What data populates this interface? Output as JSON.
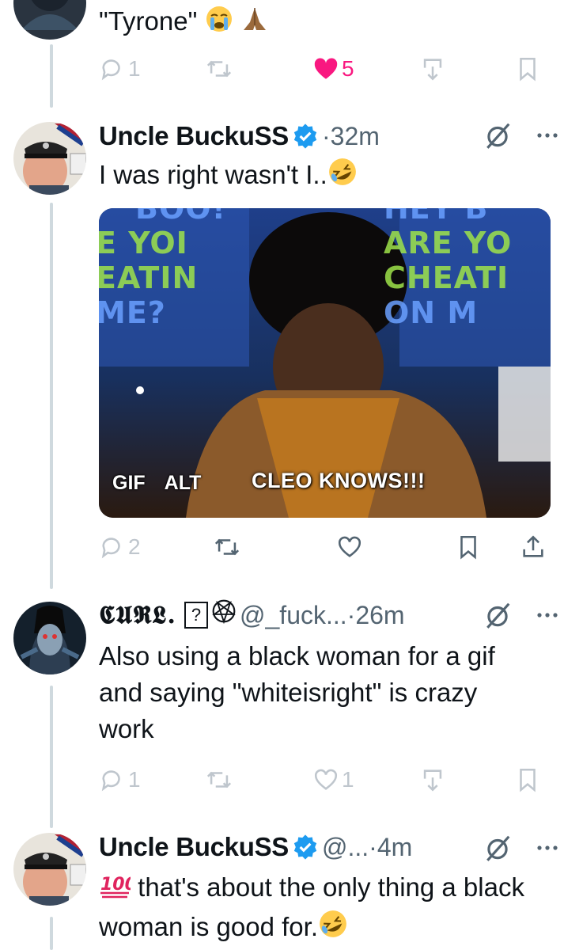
{
  "tweet1": {
    "text": "\"Tyrone\"",
    "emojis": [
      "crying-face",
      "folded-hands"
    ],
    "actions": {
      "reply_count": "1",
      "retweet_count": "",
      "like_count": "5",
      "liked": true
    }
  },
  "tweet2": {
    "name": "Uncle BuckuSS",
    "separator": "·",
    "time": "32m",
    "text": "I was right wasn't I..",
    "emoji": "rolling-on-floor-laughing",
    "media": {
      "badge_gif": "GIF",
      "badge_alt": "ALT",
      "caption": "CLEO KNOWS!!!",
      "banner_left": [
        "BOO!",
        "E YOI",
        "EATIN",
        "ME?"
      ],
      "banner_right": [
        "HEY B",
        "ARE YO",
        "CHEATI",
        "ON M"
      ]
    },
    "actions": {
      "reply_count": "2"
    }
  },
  "tweet3": {
    "name": "𝕮𝖀𝕽𝕷.",
    "name_box": "?",
    "handle": "@_fuck...",
    "separator": "·",
    "time": "26m",
    "text": "Also using a black woman for a gif and saying \"whiteisright\" is crazy work",
    "actions": {
      "reply_count": "1",
      "like_count": "1"
    }
  },
  "tweet4": {
    "name": "Uncle BuckuSS",
    "handle": "@...",
    "separator": "·",
    "time": "4m",
    "text": "that's about the only thing a black woman is good for.",
    "emoji_lead": "hundred-points",
    "emoji_end": "rolling-on-floor-laughing"
  },
  "colors": {
    "like_pink": "#f91880",
    "verified_blue": "#1d9bf0",
    "muted": "#536471",
    "icon_gray": "#8b98a5",
    "thread_line": "#cfd9de"
  }
}
